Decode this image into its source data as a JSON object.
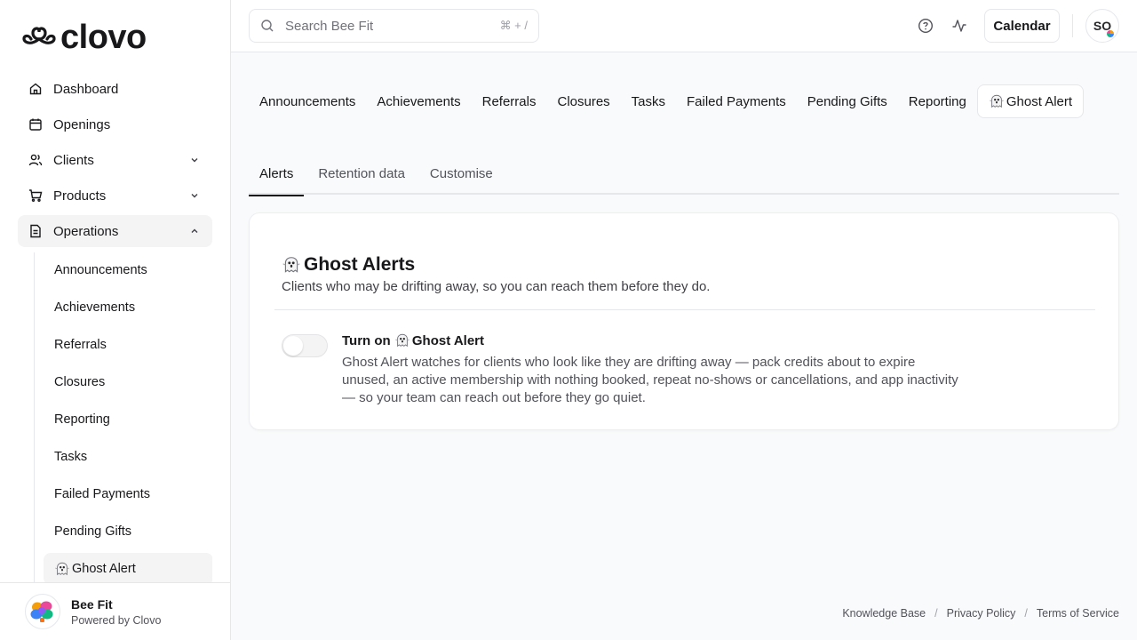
{
  "brand": {
    "name": "clovo"
  },
  "sidebar": {
    "items": [
      {
        "label": "Dashboard",
        "icon": "home-icon"
      },
      {
        "label": "Openings",
        "icon": "calendar-icon"
      },
      {
        "label": "Clients",
        "icon": "users-icon"
      },
      {
        "label": "Products",
        "icon": "cart-icon"
      },
      {
        "label": "Operations",
        "icon": "file-icon"
      }
    ],
    "operations_sub": [
      {
        "label": "Announcements"
      },
      {
        "label": "Achievements"
      },
      {
        "label": "Referrals"
      },
      {
        "label": "Closures"
      },
      {
        "label": "Reporting"
      },
      {
        "label": "Tasks"
      },
      {
        "label": "Failed Payments"
      },
      {
        "label": "Pending Gifts"
      },
      {
        "label": "Ghost Alert"
      }
    ],
    "footer": {
      "org_name": "Bee Fit",
      "powered_by": "Powered by Clovo"
    }
  },
  "header": {
    "search_placeholder": "Search Bee Fit",
    "search_shortcut": "⌘ + /",
    "calendar_label": "Calendar",
    "user_initials": "SO"
  },
  "top_tabs": [
    {
      "label": "Announcements"
    },
    {
      "label": "Achievements"
    },
    {
      "label": "Referrals"
    },
    {
      "label": "Closures"
    },
    {
      "label": "Tasks"
    },
    {
      "label": "Failed Payments"
    },
    {
      "label": "Pending Gifts"
    },
    {
      "label": "Reporting"
    },
    {
      "label": "Ghost Alert"
    }
  ],
  "sub_tabs": [
    {
      "label": "Alerts"
    },
    {
      "label": "Retention data"
    },
    {
      "label": "Customise"
    }
  ],
  "card": {
    "title": "Ghost Alerts",
    "description": "Clients who may be drifting away, so you can reach them before they do.",
    "setting_title_prefix": "Turn on ",
    "setting_title_name": "Ghost Alert",
    "setting_description": "Ghost Alert watches for clients who look like they are drifting away — pack credits about to expire unused, an active membership with nothing booked, repeat no-shows or cancellations, and app inactivity — so your team can reach out before they go quiet.",
    "toggle_on": false
  },
  "footer": {
    "links": [
      "Knowledge Base",
      "Privacy Policy",
      "Terms of Service"
    ],
    "separator": "/"
  }
}
